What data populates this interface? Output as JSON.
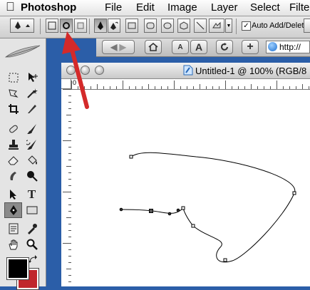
{
  "menubar": {
    "app_name": "Photoshop",
    "items": [
      "File",
      "Edit",
      "Image",
      "Layer",
      "Select",
      "Filte"
    ]
  },
  "options_bar": {
    "auto_add_delete": {
      "label": "Auto Add/Delete",
      "checked": true
    }
  },
  "browser_toolbar": {
    "font_small": "A",
    "font_large": "A",
    "add": "+",
    "url": "http://"
  },
  "document": {
    "title": "Untitled-1 @ 100% (RGB/8",
    "ruler_zero": "0"
  },
  "toolbox": {
    "type_tool": "T"
  },
  "colors": {
    "foreground": "#000000",
    "background": "#c0272d",
    "annotation_arrow": "#d42a2a",
    "desktop": "#2b5ea8"
  }
}
